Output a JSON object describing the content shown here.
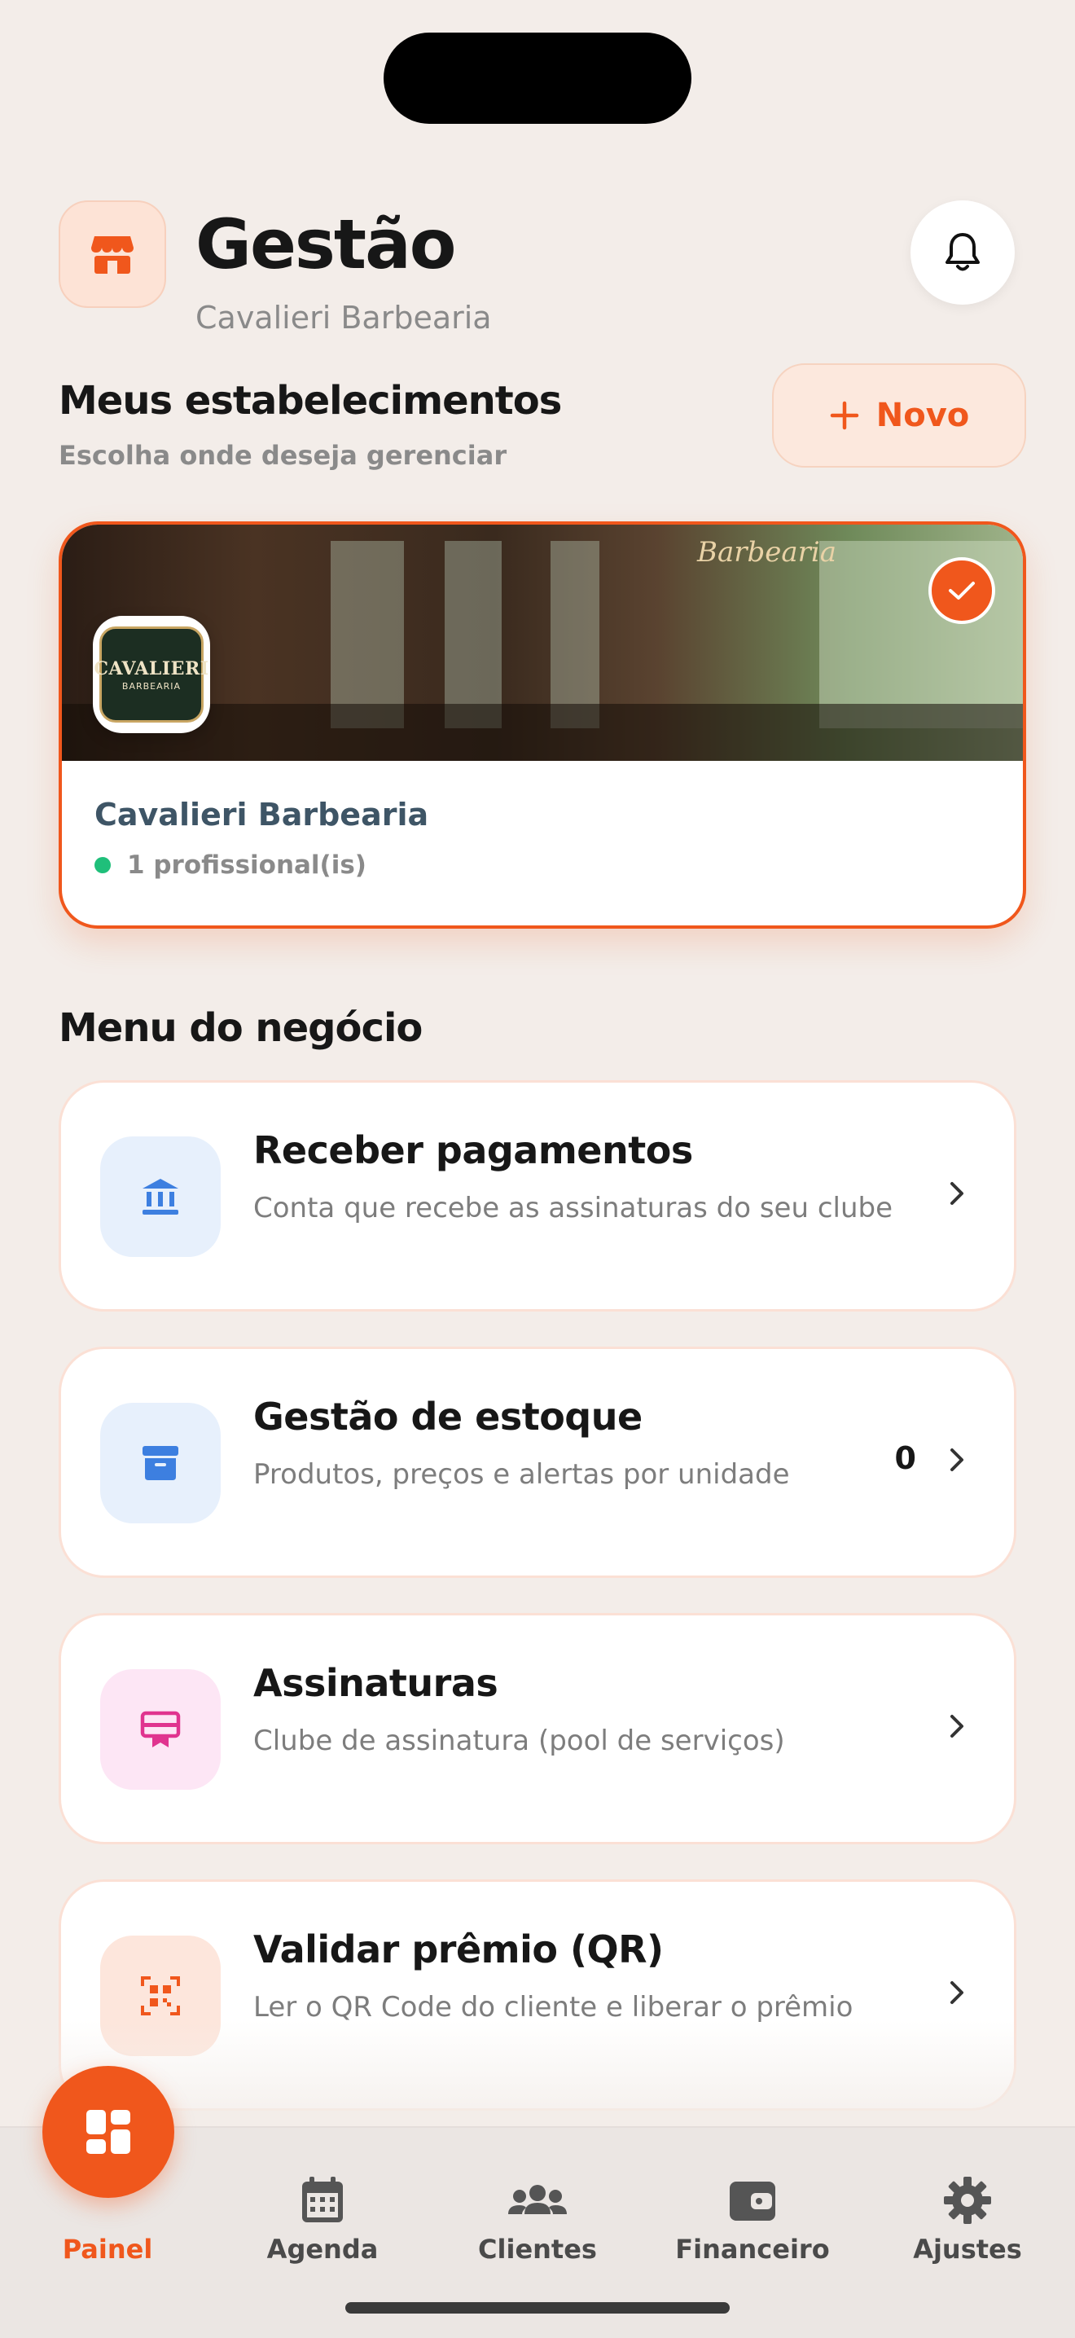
{
  "header": {
    "title": "Gestão",
    "subtitle": "Cavalieri Barbearia"
  },
  "establishments": {
    "title": "Meus estabelecimentos",
    "subtitle": "Escolha onde deseja gerenciar",
    "new_button": "Novo",
    "card": {
      "name": "Cavalieri Barbearia",
      "professionals": "1 profissional(is)",
      "logo_text": "CAVALIERI",
      "logo_sub": "BARBEARIA",
      "banner_sign": "Barbearia"
    }
  },
  "menu": {
    "title": "Menu do negócio",
    "items": [
      {
        "title": "Receber pagamentos",
        "desc": "Conta que recebe as assinaturas do seu clube",
        "icon": "bank-icon"
      },
      {
        "title": "Gestão de estoque",
        "desc": "Produtos, preços e alertas por unidade",
        "icon": "archive-box-icon",
        "count": "0"
      },
      {
        "title": "Assinaturas",
        "desc": "Clube de assinatura (pool de serviços)",
        "icon": "card-badge-icon"
      },
      {
        "title": "Validar prêmio (QR)",
        "desc": "Ler o QR Code do cliente e liberar o prêmio",
        "icon": "qr-code-icon"
      }
    ]
  },
  "tabbar": {
    "tabs": [
      {
        "label": "Painel",
        "icon": "dashboard-grid-icon",
        "active": true
      },
      {
        "label": "Agenda",
        "icon": "calendar-icon"
      },
      {
        "label": "Clientes",
        "icon": "users-icon"
      },
      {
        "label": "Financeiro",
        "icon": "wallet-icon"
      },
      {
        "label": "Ajustes",
        "icon": "gear-icon"
      }
    ]
  },
  "colors": {
    "accent": "#f0571c",
    "background": "#f3ede9",
    "success": "#1fbf7a"
  }
}
